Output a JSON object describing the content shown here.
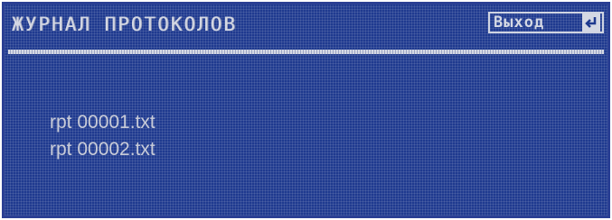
{
  "header": {
    "title": "ЖУРНАЛ ПРОТОКОЛОВ",
    "exit_label": "Выход",
    "exit_icon": "return-arrow-icon"
  },
  "files": [
    {
      "name": "rpt 00001.txt"
    },
    {
      "name": "rpt 00002.txt"
    }
  ],
  "colors": {
    "background": "#1f3a8f",
    "text": "#d4d8e4"
  }
}
